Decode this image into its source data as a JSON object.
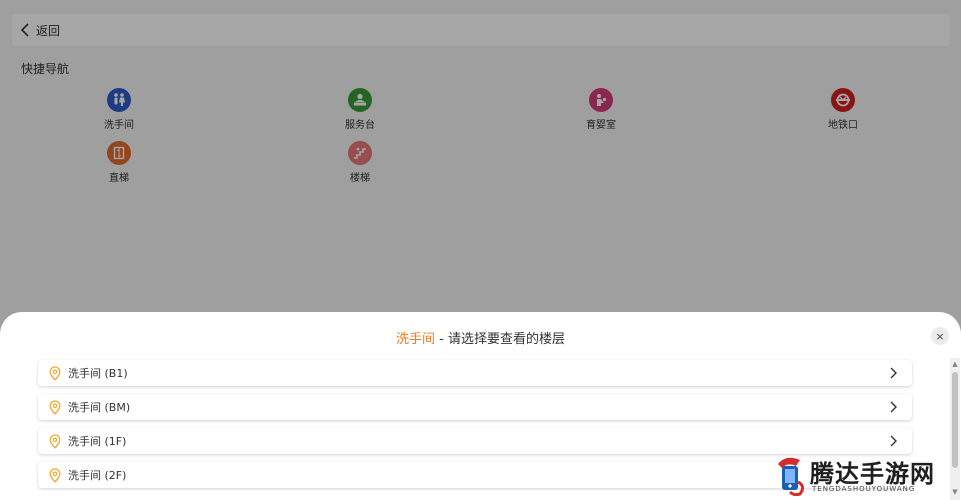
{
  "header": {
    "back_label": "返回"
  },
  "quick_nav": {
    "title": "快捷导航",
    "items": [
      {
        "label": "洗手间",
        "icon": "restroom-icon",
        "color": "#2e5dc8"
      },
      {
        "label": "服务台",
        "icon": "service-desk-icon",
        "color": "#3a9a3a"
      },
      {
        "label": "育婴室",
        "icon": "nursery-icon",
        "color": "#d63d7a"
      },
      {
        "label": "地铁口",
        "icon": "metro-icon",
        "color": "#d11f1f"
      },
      {
        "label": "直梯",
        "icon": "elevator-icon",
        "color": "#e56a2c"
      },
      {
        "label": "楼梯",
        "icon": "stairs-icon",
        "color": "#e6787a"
      }
    ]
  },
  "sheet": {
    "title_highlight": "洗手间",
    "title_rest": " - 请选择要查看的楼层",
    "close_label": "×",
    "floors": [
      {
        "label": "洗手间 (B1)"
      },
      {
        "label": "洗手间 (BM)"
      },
      {
        "label": "洗手间 (1F)"
      },
      {
        "label": "洗手间 (2F)"
      }
    ],
    "accent_color": "#f07a1c"
  },
  "watermark": {
    "title": "腾达手游网",
    "subtitle": "TENGDASHOUYOUWANG"
  }
}
